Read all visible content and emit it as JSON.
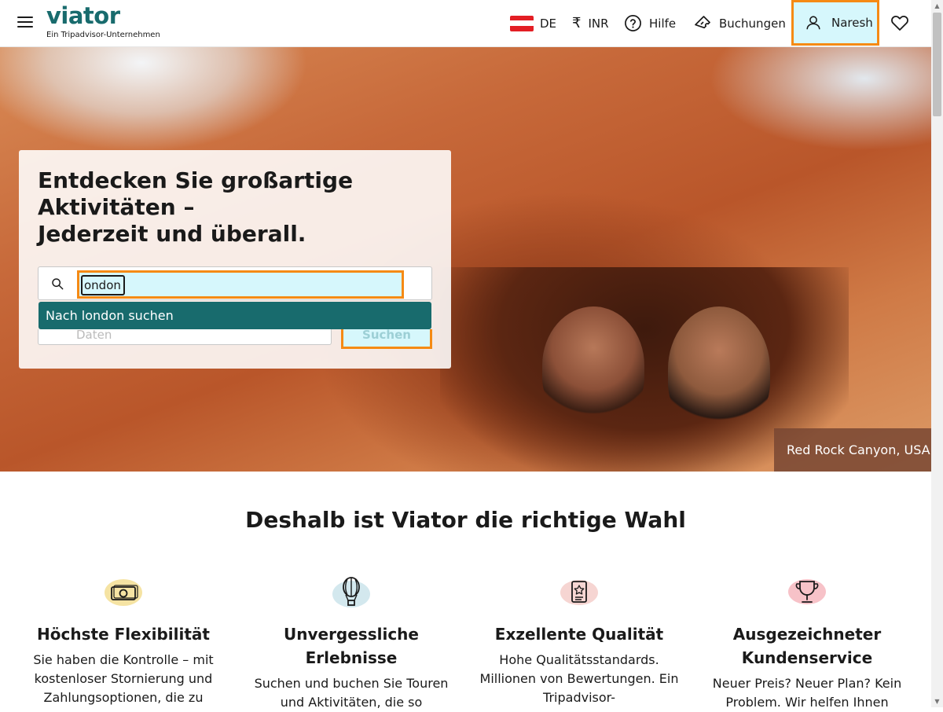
{
  "header": {
    "logo": "viator",
    "logo_sub": "Ein Tripadvisor-Unternehmen",
    "language": "DE",
    "currency": "INR",
    "currency_symbol": "₹",
    "help": "Hilfe",
    "bookings": "Buchungen",
    "user": "Naresh"
  },
  "hero": {
    "title_line1": "Entdecken Sie großartige",
    "title_line2": "Aktivitäten –",
    "title_line3": "Jederzeit und überall.",
    "search_value": "london",
    "search_visible_value": "ondon",
    "suggestion": "Nach london suchen",
    "date_placeholder": "Daten",
    "search_button": "Suchen",
    "caption": "Red Rock Canyon, USA"
  },
  "why": {
    "title": "Deshalb ist Viator die richtige Wahl",
    "features": [
      {
        "title": "Höchste Flexibilität",
        "desc": "Sie haben die Kontrolle – mit kostenloser Stornierung und Zahlungsoptionen, die zu",
        "icon": "money-icon"
      },
      {
        "title": "Unvergessliche Erlebnisse",
        "desc": "Suchen und buchen Sie Touren und Aktivitäten, die so",
        "icon": "hot-air-balloon-icon"
      },
      {
        "title": "Exzellente Qualität",
        "desc": "Hohe Qualitätsstandards. Millionen von Bewertungen. Ein Tripadvisor-",
        "icon": "certificate-icon"
      },
      {
        "title": "Ausgezeichneter Kundenservice",
        "desc": "Neuer Preis? Neuer Plan? Kein Problem. Wir helfen Ihnen",
        "icon": "trophy-icon"
      }
    ]
  },
  "colors": {
    "brand": "#186b6d",
    "focus_outline": "#f58a14",
    "highlight": "#d6f7fc"
  }
}
